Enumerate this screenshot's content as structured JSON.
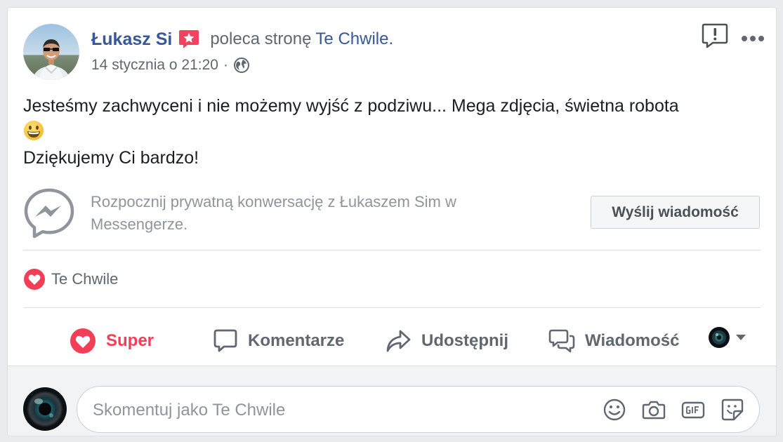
{
  "post": {
    "author_name": "Łukasz Si",
    "action_text": "poleca stronę",
    "page_name": "Te Chwile.",
    "timestamp": "14 stycznia o 21:20",
    "separator": "·",
    "body_line1": "Jesteśmy zachwyceni i nie możemy wyjść z podziwu... Mega zdjęcia, świetna robota",
    "body_line2": "Dziękujemy Ci bardzo!"
  },
  "messenger": {
    "prompt": "Rozpocznij prywatną konwersację z Łukaszem Sim w Messengerze.",
    "button_label": "Wyślij wiadomość"
  },
  "reactions": {
    "label": "Te Chwile"
  },
  "actions": {
    "love_label": "Super",
    "comment_label": "Komentarze",
    "share_label": "Udostępnij",
    "message_label": "Wiadomość"
  },
  "comment": {
    "placeholder": "Skomentuj jako Te Chwile"
  },
  "colors": {
    "link": "#385898",
    "love": "#f33e58",
    "muted": "#606770",
    "placeholder": "#90949c",
    "background": "#e9ebee"
  },
  "icons": [
    "avatar",
    "recommend-star-badge",
    "globe-icon",
    "report-icon",
    "more-options-icon",
    "grinning-emoji",
    "messenger-icon",
    "heart-reaction-icon",
    "comment-icon",
    "share-icon",
    "message-icon",
    "audience-selector",
    "emoji-icon",
    "camera-icon",
    "gif-icon",
    "sticker-icon"
  ]
}
